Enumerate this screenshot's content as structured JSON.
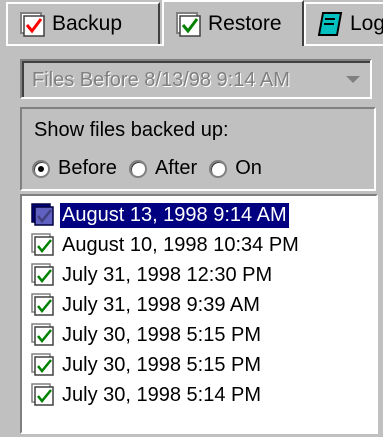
{
  "tabs": [
    {
      "label": "Backup",
      "icon": "backup-checkbox-icon"
    },
    {
      "label": "Restore",
      "icon": "restore-checkbox-icon"
    },
    {
      "label": "Log",
      "icon": "log-book-icon"
    }
  ],
  "dropdown": {
    "value": "Files Before 8/13/98 9:14 AM",
    "icon": "dropdown-arrow-icon"
  },
  "filter": {
    "title": "Show files backed up:",
    "options": [
      {
        "label": "Before",
        "checked": true
      },
      {
        "label": "After",
        "checked": false
      },
      {
        "label": "On",
        "checked": false
      }
    ]
  },
  "backups": [
    {
      "label": "August 13, 1998 9:14 AM",
      "selected": true
    },
    {
      "label": "August 10, 1998 10:34 PM",
      "selected": false
    },
    {
      "label": "July 31, 1998 12:30 PM",
      "selected": false
    },
    {
      "label": "July 31, 1998 9:39 AM",
      "selected": false
    },
    {
      "label": "July 30, 1998 5:15 PM",
      "selected": false
    },
    {
      "label": "July 30, 1998 5:15 PM",
      "selected": false
    },
    {
      "label": "July 30, 1998 5:14 PM",
      "selected": false
    }
  ],
  "colors": {
    "face": "#c0c0c0",
    "selection": "#000080",
    "check_red": "#ff0000",
    "check_green": "#008000"
  }
}
